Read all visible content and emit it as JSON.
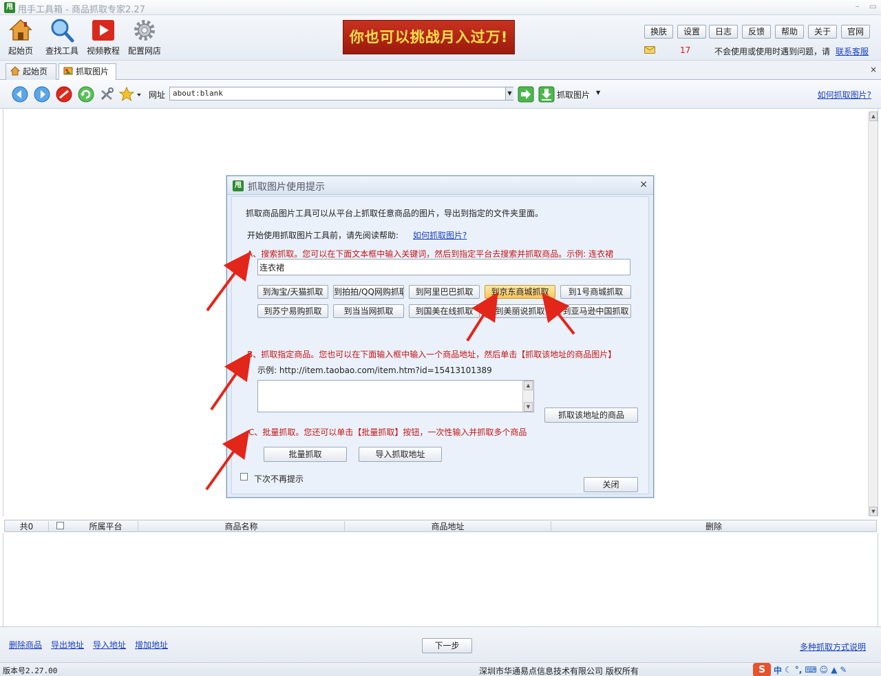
{
  "window": {
    "title": "甩手工具箱 - 商品抓取专家2.27",
    "app_badge": "甩",
    "minimize": "–",
    "maximize": "▭",
    "close": "×"
  },
  "toolbar": {
    "home": "起始页",
    "find_tool": "查找工具",
    "video": "视频教程",
    "config_shop": "配置网店"
  },
  "banner": {
    "text": "你也可以挑战月入过万!"
  },
  "top_buttons": [
    "换肤",
    "设置",
    "日志",
    "反馈",
    "帮助",
    "关于",
    "官网"
  ],
  "notice": {
    "count": "17",
    "message": "不会使用或使用时遇到问题，请",
    "link": "联系客服"
  },
  "tabs": [
    {
      "label": "起始页"
    },
    {
      "label": "抓取图片"
    }
  ],
  "tab_close": "×",
  "nav": {
    "url_label": "网址",
    "url_value": "about:blank",
    "grab_label": "抓取图片",
    "help_link": "如何抓取图片?"
  },
  "dialog": {
    "badge": "甩",
    "title": "抓取图片使用提示",
    "close": "×",
    "intro": "抓取商品图片工具可以从平台上抓取任意商品的图片，导出到指定的文件夹里面。",
    "read_help": "开始使用抓取图片工具前，请先阅读帮助:",
    "read_help_link": "如何抓取图片?",
    "section_a": "A、搜索抓取。您可以在下面文本框中输入关键词，然后到指定平台去搜索并抓取商品。示例: 连衣裙",
    "keyword_value": "连衣裙",
    "platform_buttons": [
      "到淘宝/天猫抓取",
      "到拍拍/QQ网购抓取",
      "到阿里巴巴抓取",
      "到京东商城抓取",
      "到1号商城抓取",
      "到苏宁易购抓取",
      "到当当网抓取",
      "到国美在线抓取",
      "到美丽说抓取",
      "到亚马逊中国抓取"
    ],
    "section_b": "B、抓取指定商品。您也可以在下面输入框中输入一个商品地址，然后单击【抓取该地址的商品图片】",
    "example": "示例: http://item.taobao.com/item.htm?id=15413101389",
    "grab_this": "抓取该地址的商品",
    "section_c": "C、批量抓取。您还可以单击【批量抓取】按钮，一次性输入并抓取多个商品",
    "batch_button": "批量抓取",
    "import_button": "导入抓取地址",
    "no_more": "下次不再提示",
    "close_button": "关闭"
  },
  "table": {
    "count": "共0",
    "columns": [
      "所属平台",
      "商品名称",
      "商品地址",
      "删除"
    ]
  },
  "footer": {
    "links": [
      "删除商品",
      "导出地址",
      "导入地址",
      "增加地址"
    ],
    "next": "下一步",
    "modes_link": "多种抓取方式说明"
  },
  "status": {
    "version": "版本号2.27.00",
    "copyright": "深圳市华通易点信息技术有限公司 版权所有"
  },
  "ime": {
    "logo": "S",
    "mode": "中"
  },
  "colors": {
    "accent_red": "#c41414",
    "link_blue": "#1a3fbf",
    "highlight": "#f7c35a",
    "banner_bg": "#b22515",
    "banner_text": "#ffe14a"
  }
}
